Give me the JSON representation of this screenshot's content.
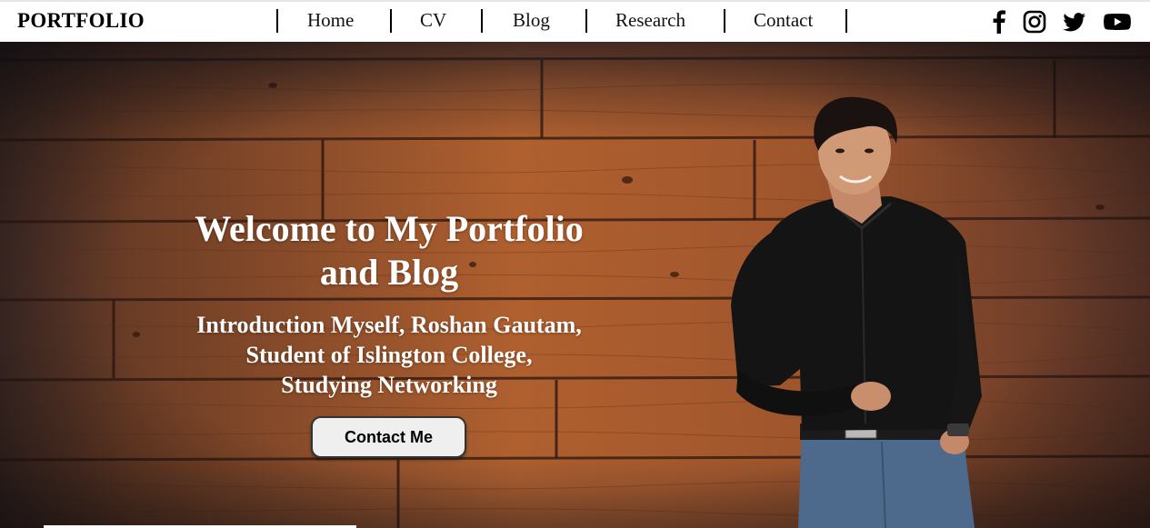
{
  "brand": "PORTFOLIO",
  "nav": {
    "links": [
      "Home",
      "CV",
      "Blog",
      "Research",
      "Contact"
    ]
  },
  "social": [
    "facebook-icon",
    "instagram-icon",
    "twitter-icon",
    "youtube-icon"
  ],
  "hero": {
    "title_line1": "Welcome to My Portfolio",
    "title_line2": "and Blog",
    "intro_line1": "Introduction Myself, Roshan Gautam,",
    "intro_line2": "Student of Islington College,",
    "intro_line3": "Studying Networking",
    "button_label": "Contact Me"
  },
  "colors": {
    "wood": "#8a4a26",
    "wood_dark": "#3b2a28",
    "text": "#ffffff",
    "button_bg": "#efefef"
  }
}
